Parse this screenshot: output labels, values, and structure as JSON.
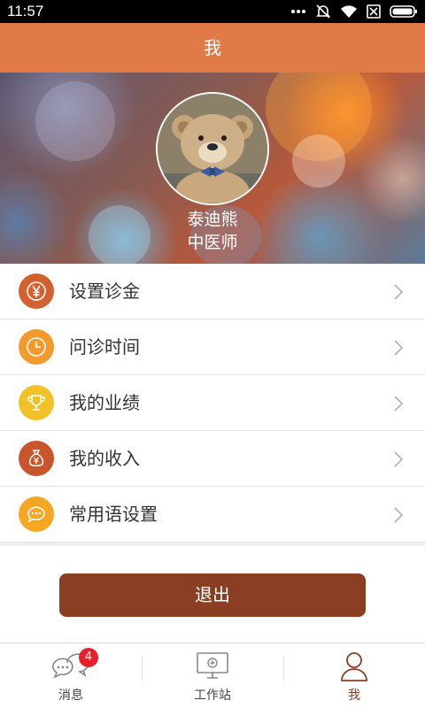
{
  "status_bar": {
    "time": "11:57"
  },
  "header": {
    "title": "我"
  },
  "profile": {
    "name": "泰迪熊",
    "title": "中医师"
  },
  "menu": {
    "items": [
      {
        "label": "设置诊金",
        "icon": "yen-icon",
        "color": "#d3612f"
      },
      {
        "label": "问诊时间",
        "icon": "clock-icon",
        "color": "#f29a2e"
      },
      {
        "label": "我的业绩",
        "icon": "trophy-icon",
        "color": "#f0c228"
      },
      {
        "label": "我的收入",
        "icon": "money-bag-icon",
        "color": "#c9552b"
      },
      {
        "label": "常用语设置",
        "icon": "speech-bubble-icon",
        "color": "#f5a623"
      }
    ]
  },
  "logout": {
    "label": "退出"
  },
  "tabs": [
    {
      "label": "消息",
      "icon": "chat-bubbles-icon",
      "badge": "4",
      "active": false
    },
    {
      "label": "工作站",
      "icon": "monitor-icon",
      "active": false
    },
    {
      "label": "我",
      "icon": "person-icon",
      "active": true
    }
  ],
  "colors": {
    "header_bg": "#e07a47",
    "logout_bg": "#8a3f23",
    "active_tab": "#8a3f23",
    "badge": "#e8202a"
  }
}
